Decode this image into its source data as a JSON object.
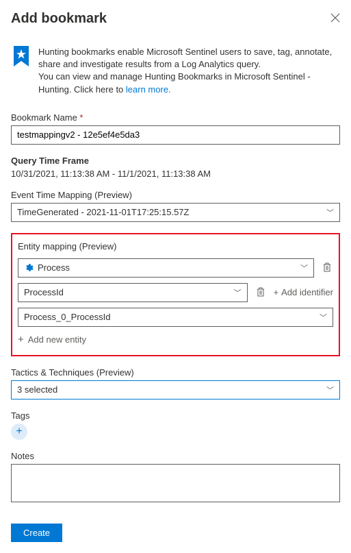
{
  "header": {
    "title": "Add bookmark"
  },
  "banner": {
    "line1": "Hunting bookmarks enable Microsoft Sentinel users to save, tag, annotate, share and investigate results from a Log Analytics query.",
    "line2_prefix": "You can view and manage Hunting Bookmarks in Microsoft Sentinel - Hunting. Click here to ",
    "learn_more": "learn more."
  },
  "bookmark_name": {
    "label": "Bookmark Name",
    "value": "testmappingv2 - 12e5ef4e5da3"
  },
  "query_time": {
    "label": "Query Time Frame",
    "value": "10/31/2021, 11:13:38 AM - 11/1/2021, 11:13:38 AM"
  },
  "event_time": {
    "label": "Event Time Mapping (Preview)",
    "value": "TimeGenerated - 2021-11-01T17:25:15.57Z"
  },
  "entity": {
    "label": "Entity mapping (Preview)",
    "type_value": "Process",
    "identifier_value": "ProcessId",
    "identifier2_value": "Process_0_ProcessId",
    "add_identifier": "Add identifier",
    "add_entity": "Add new entity"
  },
  "tactics": {
    "label": "Tactics & Techniques (Preview)",
    "value": "3 selected"
  },
  "tags": {
    "label": "Tags"
  },
  "notes": {
    "label": "Notes"
  },
  "footer": {
    "create": "Create"
  }
}
